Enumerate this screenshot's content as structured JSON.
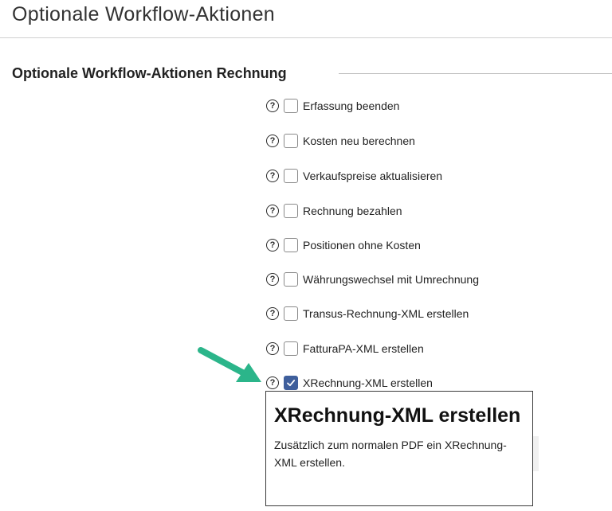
{
  "page": {
    "title": "Optionale Workflow-Aktionen"
  },
  "section": {
    "legend": "Optionale Workflow-Aktionen Rechnung"
  },
  "options": [
    {
      "label": "Erfassung beenden",
      "checked": false
    },
    {
      "label": "Kosten neu berechnen",
      "checked": false
    },
    {
      "label": "Verkaufspreise aktualisieren",
      "checked": false
    },
    {
      "label": "Rechnung bezahlen",
      "checked": false
    },
    {
      "label": "Positionen ohne Kosten",
      "checked": false
    },
    {
      "label": "Währungswechsel mit Umrechnung",
      "checked": false
    },
    {
      "label": "Transus-Rechnung-XML erstellen",
      "checked": false
    },
    {
      "label": "FatturaPA-XML erstellen",
      "checked": false
    },
    {
      "label": "XRechnung-XML erstellen",
      "checked": true
    }
  ],
  "help_icon": {
    "name": "question-circle-icon",
    "glyph": "?"
  },
  "tooltip": {
    "title": "XRechnung-XML erstellen",
    "body": "Zusätzlich zum normalen PDF ein XRechnung-XML erstellen."
  },
  "colors": {
    "arrow": "#2bb58a",
    "checkbox_checked": "#3f5f9c"
  }
}
